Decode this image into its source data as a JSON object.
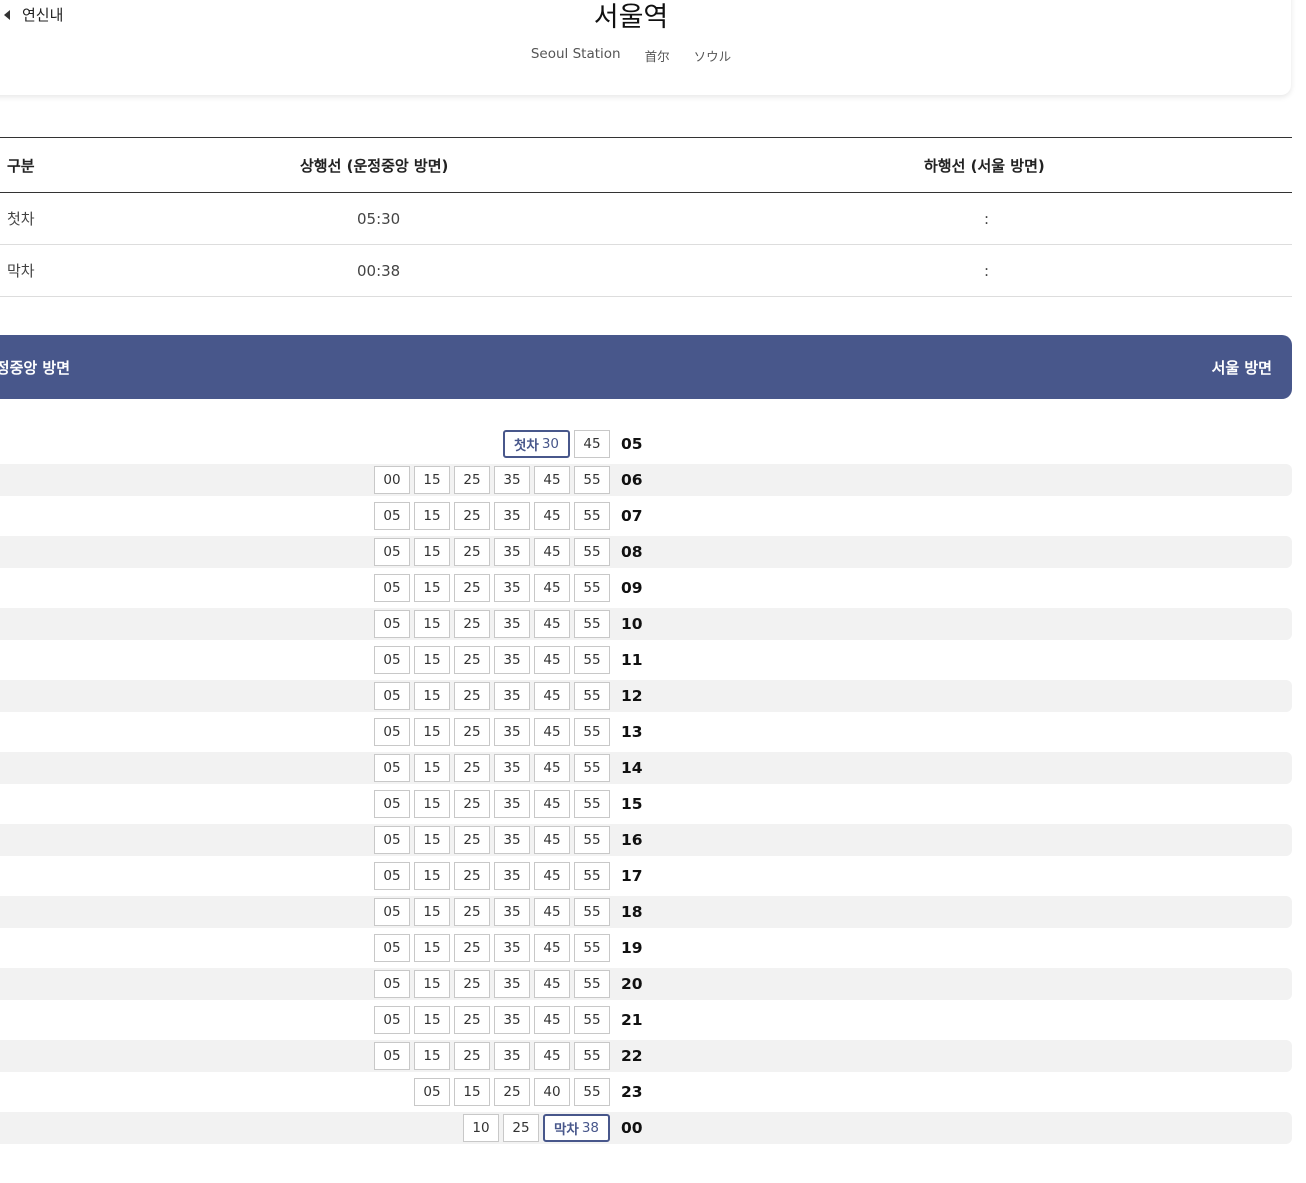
{
  "header": {
    "back_label": "연신내",
    "station_name": "서울역",
    "name_en": "Seoul Station",
    "name_zh": "首尔",
    "name_ja": "ソウル"
  },
  "first_last_table": {
    "headers": [
      "구분",
      "상행선 (운정중앙 방면)",
      "하행선 (서울 방면)"
    ],
    "rows": [
      {
        "label": "첫차",
        "up": "05:30",
        "down": ":"
      },
      {
        "label": "막차",
        "up": "00:38",
        "down": ":"
      }
    ]
  },
  "direction_tabs": {
    "left": "운정중앙 방면",
    "right": "서울 방면"
  },
  "timetable": [
    {
      "hour": "05",
      "minutes": [
        {
          "m": "30",
          "tag": "첫차"
        },
        {
          "m": "45"
        }
      ]
    },
    {
      "hour": "06",
      "minutes": [
        {
          "m": "00"
        },
        {
          "m": "15"
        },
        {
          "m": "25"
        },
        {
          "m": "35"
        },
        {
          "m": "45"
        },
        {
          "m": "55"
        }
      ]
    },
    {
      "hour": "07",
      "minutes": [
        {
          "m": "05"
        },
        {
          "m": "15"
        },
        {
          "m": "25"
        },
        {
          "m": "35"
        },
        {
          "m": "45"
        },
        {
          "m": "55"
        }
      ]
    },
    {
      "hour": "08",
      "minutes": [
        {
          "m": "05"
        },
        {
          "m": "15"
        },
        {
          "m": "25"
        },
        {
          "m": "35"
        },
        {
          "m": "45"
        },
        {
          "m": "55"
        }
      ]
    },
    {
      "hour": "09",
      "minutes": [
        {
          "m": "05"
        },
        {
          "m": "15"
        },
        {
          "m": "25"
        },
        {
          "m": "35"
        },
        {
          "m": "45"
        },
        {
          "m": "55"
        }
      ]
    },
    {
      "hour": "10",
      "minutes": [
        {
          "m": "05"
        },
        {
          "m": "15"
        },
        {
          "m": "25"
        },
        {
          "m": "35"
        },
        {
          "m": "45"
        },
        {
          "m": "55"
        }
      ]
    },
    {
      "hour": "11",
      "minutes": [
        {
          "m": "05"
        },
        {
          "m": "15"
        },
        {
          "m": "25"
        },
        {
          "m": "35"
        },
        {
          "m": "45"
        },
        {
          "m": "55"
        }
      ]
    },
    {
      "hour": "12",
      "minutes": [
        {
          "m": "05"
        },
        {
          "m": "15"
        },
        {
          "m": "25"
        },
        {
          "m": "35"
        },
        {
          "m": "45"
        },
        {
          "m": "55"
        }
      ]
    },
    {
      "hour": "13",
      "minutes": [
        {
          "m": "05"
        },
        {
          "m": "15"
        },
        {
          "m": "25"
        },
        {
          "m": "35"
        },
        {
          "m": "45"
        },
        {
          "m": "55"
        }
      ]
    },
    {
      "hour": "14",
      "minutes": [
        {
          "m": "05"
        },
        {
          "m": "15"
        },
        {
          "m": "25"
        },
        {
          "m": "35"
        },
        {
          "m": "45"
        },
        {
          "m": "55"
        }
      ]
    },
    {
      "hour": "15",
      "minutes": [
        {
          "m": "05"
        },
        {
          "m": "15"
        },
        {
          "m": "25"
        },
        {
          "m": "35"
        },
        {
          "m": "45"
        },
        {
          "m": "55"
        }
      ]
    },
    {
      "hour": "16",
      "minutes": [
        {
          "m": "05"
        },
        {
          "m": "15"
        },
        {
          "m": "25"
        },
        {
          "m": "35"
        },
        {
          "m": "45"
        },
        {
          "m": "55"
        }
      ]
    },
    {
      "hour": "17",
      "minutes": [
        {
          "m": "05"
        },
        {
          "m": "15"
        },
        {
          "m": "25"
        },
        {
          "m": "35"
        },
        {
          "m": "45"
        },
        {
          "m": "55"
        }
      ]
    },
    {
      "hour": "18",
      "minutes": [
        {
          "m": "05"
        },
        {
          "m": "15"
        },
        {
          "m": "25"
        },
        {
          "m": "35"
        },
        {
          "m": "45"
        },
        {
          "m": "55"
        }
      ]
    },
    {
      "hour": "19",
      "minutes": [
        {
          "m": "05"
        },
        {
          "m": "15"
        },
        {
          "m": "25"
        },
        {
          "m": "35"
        },
        {
          "m": "45"
        },
        {
          "m": "55"
        }
      ]
    },
    {
      "hour": "20",
      "minutes": [
        {
          "m": "05"
        },
        {
          "m": "15"
        },
        {
          "m": "25"
        },
        {
          "m": "35"
        },
        {
          "m": "45"
        },
        {
          "m": "55"
        }
      ]
    },
    {
      "hour": "21",
      "minutes": [
        {
          "m": "05"
        },
        {
          "m": "15"
        },
        {
          "m": "25"
        },
        {
          "m": "35"
        },
        {
          "m": "45"
        },
        {
          "m": "55"
        }
      ]
    },
    {
      "hour": "22",
      "minutes": [
        {
          "m": "05"
        },
        {
          "m": "15"
        },
        {
          "m": "25"
        },
        {
          "m": "35"
        },
        {
          "m": "45"
        },
        {
          "m": "55"
        }
      ]
    },
    {
      "hour": "23",
      "minutes": [
        {
          "m": "05"
        },
        {
          "m": "15"
        },
        {
          "m": "25"
        },
        {
          "m": "40"
        },
        {
          "m": "55"
        }
      ]
    },
    {
      "hour": "00",
      "minutes": [
        {
          "m": "10"
        },
        {
          "m": "25"
        },
        {
          "m": "38",
          "tag": "막차"
        }
      ]
    }
  ],
  "colors": {
    "accent": "#48578b",
    "stripe": "#f2f2f2"
  }
}
